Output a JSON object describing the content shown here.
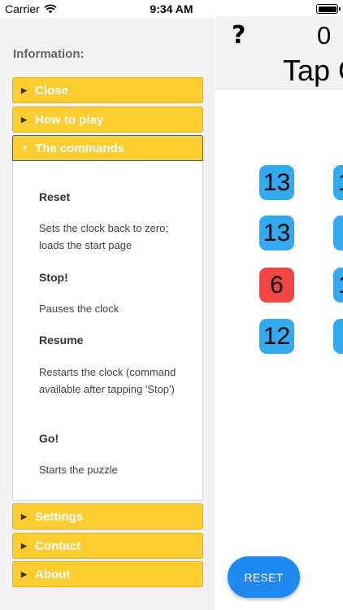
{
  "status_bar": {
    "carrier": "Carrier",
    "time": "9:34 AM"
  },
  "main": {
    "help_label": "?",
    "counter": "0",
    "tap_text": "Tap G",
    "tiles": [
      "13",
      "1",
      "13",
      "",
      "6",
      "1",
      "12",
      ""
    ],
    "tile_colors": {
      "blue": "#33aaf0",
      "red": "#f44545"
    },
    "reset_label": "RESET"
  },
  "panel": {
    "title": "Information:",
    "sections": {
      "close": "Close",
      "how_to_play": "How to play",
      "commands": "The commands",
      "settings": "Settings",
      "contact": "Contact",
      "about": "About"
    },
    "commands": [
      {
        "name": "Reset",
        "desc": "Sets the clock back to zero; loads the start page"
      },
      {
        "name": "Stop!",
        "desc": "Pauses the clock"
      },
      {
        "name": "Resume",
        "desc": "Restarts the clock (command available after tapping 'Stop')"
      },
      {
        "name": "Go!",
        "desc": "Starts the puzzle"
      }
    ],
    "accent_color": "#fdcc2f"
  }
}
